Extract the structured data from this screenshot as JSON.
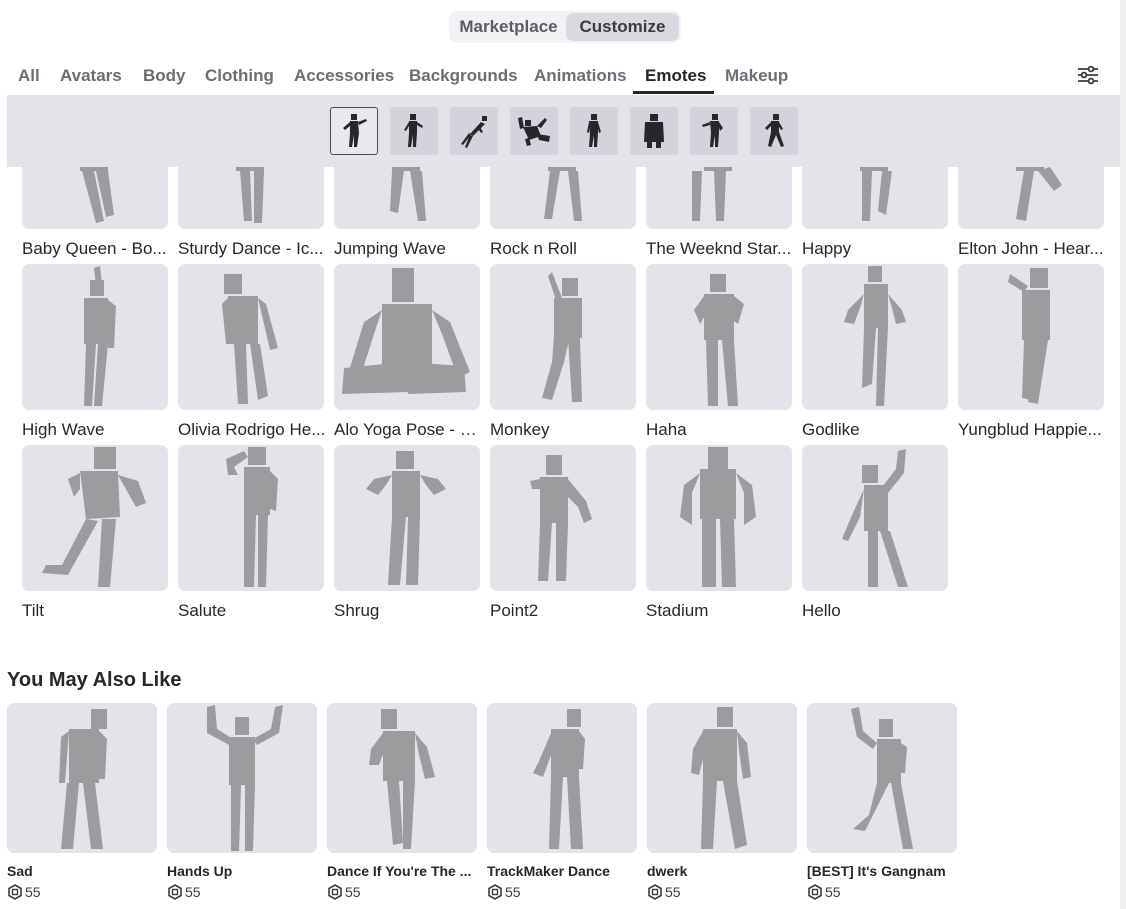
{
  "toggle": {
    "marketplace": "Marketplace",
    "customize": "Customize"
  },
  "tabs": [
    "All",
    "Avatars",
    "Body",
    "Clothing",
    "Accessories",
    "Backgrounds",
    "Animations",
    "Emotes",
    "Makeup"
  ],
  "active_tab": "Emotes",
  "subfilters": [
    "emote-pose-icon",
    "emote-pose-icon",
    "emote-pose-icon",
    "emote-pose-icon",
    "emote-pose-icon",
    "emote-pose-icon",
    "emote-pose-icon",
    "emote-pose-icon"
  ],
  "items": [
    {
      "name": "Baby Queen - Bo..."
    },
    {
      "name": "Sturdy Dance - Ic..."
    },
    {
      "name": "Jumping Wave"
    },
    {
      "name": "Rock n Roll"
    },
    {
      "name": "The Weeknd Star..."
    },
    {
      "name": "Happy"
    },
    {
      "name": "Elton John - Hear..."
    },
    {
      "name": "High Wave"
    },
    {
      "name": "Olivia Rodrigo He..."
    },
    {
      "name": "Alo Yoga Pose - L..."
    },
    {
      "name": "Monkey"
    },
    {
      "name": "Haha"
    },
    {
      "name": "Godlike"
    },
    {
      "name": "Yungblud Happie..."
    },
    {
      "name": "Tilt"
    },
    {
      "name": "Salute"
    },
    {
      "name": "Shrug"
    },
    {
      "name": "Point2"
    },
    {
      "name": "Stadium"
    },
    {
      "name": "Hello"
    }
  ],
  "recommendations": {
    "title": "You May Also Like",
    "items": [
      {
        "name": "Sad",
        "price": "55"
      },
      {
        "name": "Hands Up",
        "price": "55"
      },
      {
        "name": "Dance If You're The ...",
        "price": "55"
      },
      {
        "name": "TrackMaker Dance",
        "price": "55"
      },
      {
        "name": "dwerk",
        "price": "55"
      },
      {
        "name": "[BEST] It's Gangnam",
        "price": "55"
      }
    ]
  },
  "colors": {
    "thumb_bg": "#e3e4e9",
    "figure": "#9c9c9f",
    "strip_bg": "#e3e4e9"
  }
}
